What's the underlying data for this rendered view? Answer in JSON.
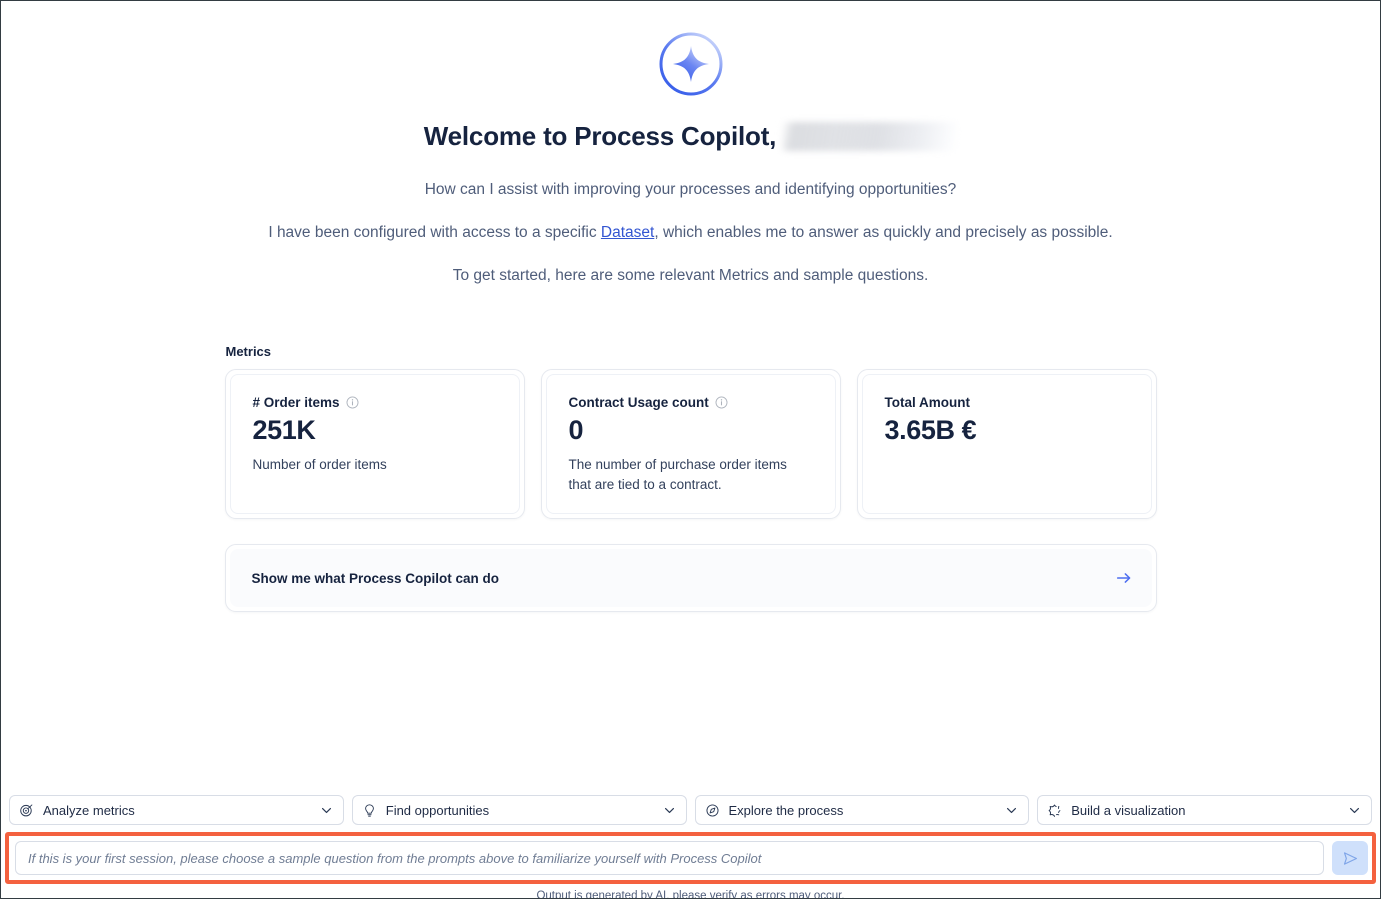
{
  "hero": {
    "logo_icon": "sparkle-badge-icon",
    "welcome_title": "Welcome to Process Copilot,",
    "redacted_user_name": "",
    "line_question": "How can I assist with improving your processes and identifying opportunities?",
    "line_dataset_before": "I have been configured with access to a specific ",
    "dataset_link_label": "Dataset",
    "line_dataset_after": ", which enables me to answer as quickly and precisely as possible.",
    "line_getstarted": "To get started, here are some relevant Metrics and sample questions."
  },
  "metrics": {
    "section_label": "Metrics",
    "cards": [
      {
        "name": "# Order items",
        "value": "251K",
        "description": "Number of order items",
        "has_info_icon": true
      },
      {
        "name": "Contract Usage count",
        "value": "0",
        "description": "The number of purchase order items that are tied to a contract.",
        "has_info_icon": true
      },
      {
        "name": "Total Amount",
        "value": "3.65B €",
        "description": "",
        "has_info_icon": false
      }
    ]
  },
  "suggestion": {
    "label": "Show me what Process Copilot can do",
    "arrow_icon": "arrow-right-icon"
  },
  "prompt_categories": [
    {
      "label": "Analyze metrics",
      "icon": "target-icon"
    },
    {
      "label": "Find opportunities",
      "icon": "lightbulb-icon"
    },
    {
      "label": "Explore the process",
      "icon": "compass-icon"
    },
    {
      "label": "Build a visualization",
      "icon": "shapes-icon"
    }
  ],
  "composer": {
    "placeholder": "If this is your first session, please choose a sample question from the prompts above to familiarize yourself with Process Copilot",
    "value": "",
    "send_icon": "send-icon",
    "highlight_color": "#f4613f"
  },
  "footer": {
    "disclaimer": "Output is generated by AI, please verify as errors may occur."
  },
  "theme": {
    "accent": "#3355d1",
    "text_dark": "#16233f",
    "text_muted": "#4f5d7a"
  }
}
